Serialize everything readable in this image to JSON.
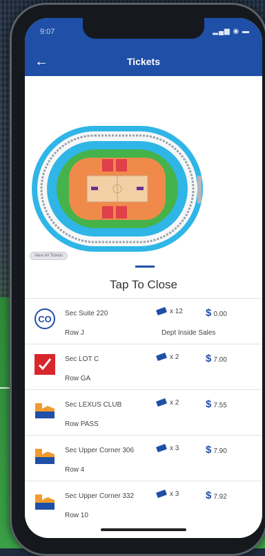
{
  "status": {
    "time": "9:07",
    "icons": "signal wifi battery"
  },
  "header": {
    "title": "Tickets"
  },
  "map": {
    "view_all_label": "View All Tickets"
  },
  "sheet": {
    "tap_to_close": "Tap To Close"
  },
  "tickets": [
    {
      "icon": "co-logo-icon",
      "section": "Sec Suite 220",
      "row": "Row J",
      "qty": "x 12",
      "price": "0.00",
      "note": "Dept Inside Sales"
    },
    {
      "icon": "red-check-icon",
      "section": "Sec LOT C",
      "row": "Row GA",
      "qty": "x 2",
      "price": "7.00",
      "note": ""
    },
    {
      "icon": "club-logo-icon",
      "section": "Sec LEXUS CLUB",
      "row": "Row PASS",
      "qty": "x 2",
      "price": "7.55",
      "note": ""
    },
    {
      "icon": "club-logo-icon",
      "section": "Sec Upper Corner 306",
      "row": "Row 4",
      "qty": "x 3",
      "price": "7.90",
      "note": ""
    },
    {
      "icon": "club-logo-icon",
      "section": "Sec Upper Corner 332",
      "row": "Row 10",
      "qty": "x 3",
      "price": "7.92",
      "note": ""
    }
  ],
  "currency_symbol": "$",
  "colors": {
    "brand": "#1f4fa6",
    "seat_cyan": "#2fb6e6",
    "seat_green": "#46b24a",
    "seat_orange": "#f08a4b",
    "seat_red": "#e0404a"
  }
}
